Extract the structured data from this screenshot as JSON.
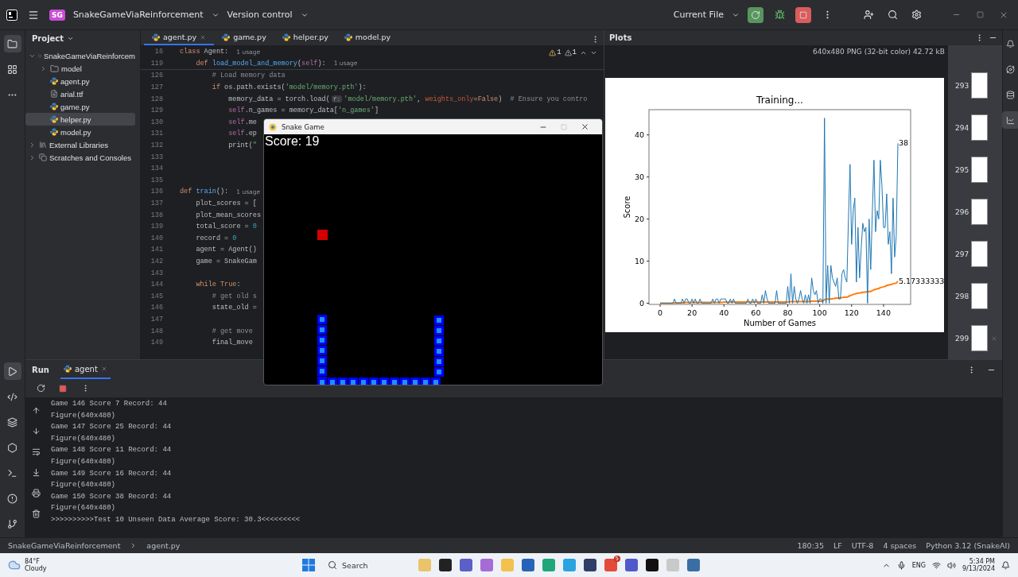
{
  "title_bar": {
    "project_badge": "SG",
    "project": "SnakeGameViaReinforcement",
    "vcs": "Version control",
    "run_config": "Current File"
  },
  "project_panel": {
    "title": "Project",
    "tree": [
      {
        "label": "SnakeGameViaReinforcem",
        "kind": "folder",
        "expanded": true,
        "selected": false,
        "children": [
          {
            "label": "model",
            "kind": "folder",
            "expanded": false,
            "selected": false
          },
          {
            "label": "agent.py",
            "kind": "python",
            "selected": false
          },
          {
            "label": "arial.ttf",
            "kind": "font",
            "selected": false
          },
          {
            "label": "game.py",
            "kind": "python",
            "selected": false
          },
          {
            "label": "helper.py",
            "kind": "python",
            "selected": true
          },
          {
            "label": "model.py",
            "kind": "python",
            "selected": false
          }
        ]
      },
      {
        "label": "External Libraries",
        "kind": "library",
        "expanded": false,
        "selected": false
      },
      {
        "label": "Scratches and Consoles",
        "kind": "scratch",
        "expanded": false,
        "selected": false
      }
    ]
  },
  "editor": {
    "tabs": [
      {
        "label": "agent.py",
        "selected": true
      },
      {
        "label": "game.py",
        "selected": false
      },
      {
        "label": "helper.py",
        "selected": false
      },
      {
        "label": "model.py",
        "selected": false
      }
    ],
    "warnings": [
      "1",
      "1"
    ],
    "sticky_lines": [
      {
        "no": "16",
        "parts": [
          {
            "t": "class",
            "kind": "kw"
          },
          {
            "t": " Agent:",
            "kind": "plain"
          },
          {
            "t": "1 usage",
            "kind": "hint"
          }
        ]
      },
      {
        "no": "119",
        "parts": [
          {
            "t": "    def",
            "kind": "kw"
          },
          {
            "t": " load_model_and_memory",
            "kind": "fn"
          },
          {
            "t": "(",
            "kind": "plain"
          },
          {
            "t": "self",
            "kind": "self"
          },
          {
            "t": "):",
            "kind": "plain"
          },
          {
            "t": "1 usage",
            "kind": "hint"
          }
        ]
      }
    ],
    "lines": [
      {
        "no": "126",
        "parts": [
          {
            "t": "        # Load memory data",
            "kind": "comment"
          }
        ]
      },
      {
        "no": "127",
        "parts": [
          {
            "t": "        if",
            "kind": "kw"
          },
          {
            "t": " os.path.exists(",
            "kind": "plain"
          },
          {
            "t": "'model/memory.pth'",
            "kind": "str"
          },
          {
            "t": "):",
            "kind": "plain"
          }
        ]
      },
      {
        "no": "128",
        "parts": [
          {
            "t": "            memory_data = torch.load(",
            "kind": "plain"
          },
          {
            "t": "f:",
            "kind": "inlay"
          },
          {
            "t": "'model/memory.pth'",
            "kind": "str"
          },
          {
            "t": ", ",
            "kind": "plain"
          },
          {
            "t": "weights_only",
            "kind": "param"
          },
          {
            "t": "=",
            "kind": "plain"
          },
          {
            "t": "False",
            "kind": "kw"
          },
          {
            "t": ")  ",
            "kind": "plain"
          },
          {
            "t": "# Ensure you contro",
            "kind": "comment"
          }
        ]
      },
      {
        "no": "129",
        "parts": [
          {
            "t": "            self",
            "kind": "self"
          },
          {
            "t": ".n_games = memory_data[",
            "kind": "plain"
          },
          {
            "t": "'n_games'",
            "kind": "str"
          },
          {
            "t": "]",
            "kind": "plain"
          }
        ]
      },
      {
        "no": "130",
        "parts": [
          {
            "t": "            self",
            "kind": "self"
          },
          {
            "t": ".me",
            "kind": "plain"
          }
        ]
      },
      {
        "no": "131",
        "parts": [
          {
            "t": "            self",
            "kind": "self"
          },
          {
            "t": ".ep",
            "kind": "plain"
          }
        ]
      },
      {
        "no": "132",
        "parts": [
          {
            "t": "            print(",
            "kind": "plain"
          },
          {
            "t": "\"",
            "kind": "str"
          }
        ]
      },
      {
        "no": "133"
      },
      {
        "no": "134"
      },
      {
        "no": "135"
      },
      {
        "no": "136",
        "parts": [
          {
            "t": "def",
            "kind": "kw"
          },
          {
            "t": " train",
            "kind": "fn"
          },
          {
            "t": "():",
            "kind": "plain"
          },
          {
            "t": "1 usage",
            "kind": "hint"
          }
        ]
      },
      {
        "no": "137",
        "parts": [
          {
            "t": "    plot_scores = [",
            "kind": "plain"
          }
        ]
      },
      {
        "no": "138",
        "parts": [
          {
            "t": "    plot_mean_scores",
            "kind": "plain"
          }
        ]
      },
      {
        "no": "139",
        "parts": [
          {
            "t": "    total_score = ",
            "kind": "plain"
          },
          {
            "t": "0",
            "kind": "num"
          }
        ]
      },
      {
        "no": "140",
        "parts": [
          {
            "t": "    record = ",
            "kind": "plain"
          },
          {
            "t": "0",
            "kind": "num"
          }
        ]
      },
      {
        "no": "141",
        "parts": [
          {
            "t": "    agent = Agent()",
            "kind": "plain"
          }
        ]
      },
      {
        "no": "142",
        "parts": [
          {
            "t": "    game = SnakeGam",
            "kind": "plain"
          }
        ]
      },
      {
        "no": "143"
      },
      {
        "no": "144",
        "parts": [
          {
            "t": "    while",
            "kind": "kw"
          },
          {
            "t": " True",
            "kind": "kw"
          },
          {
            "t": ":",
            "kind": "plain"
          }
        ]
      },
      {
        "no": "145",
        "parts": [
          {
            "t": "        # get old s",
            "kind": "comment"
          }
        ]
      },
      {
        "no": "146",
        "parts": [
          {
            "t": "        state_old =",
            "kind": "plain"
          }
        ]
      },
      {
        "no": "147"
      },
      {
        "no": "148",
        "parts": [
          {
            "t": "        # get move",
            "kind": "comment"
          }
        ]
      },
      {
        "no": "149",
        "parts": [
          {
            "t": "        final_move",
            "kind": "plain"
          }
        ]
      }
    ]
  },
  "plots": {
    "title": "Plots",
    "image_info": "640x480 PNG (32-bit color) 42.72 kB",
    "chart_data": {
      "type": "line",
      "title": "Training...",
      "xlabel": "Number of Games",
      "ylabel": "Score",
      "xlim": [
        -7,
        157
      ],
      "ylim": [
        0,
        46
      ],
      "xticks": [
        0,
        20,
        40,
        60,
        80,
        100,
        120,
        140
      ],
      "yticks": [
        0,
        10,
        20,
        30,
        40
      ],
      "x": [
        0,
        1,
        2,
        3,
        4,
        5,
        6,
        7,
        8,
        9,
        10,
        11,
        12,
        13,
        14,
        15,
        16,
        17,
        18,
        19,
        20,
        21,
        22,
        23,
        24,
        25,
        26,
        27,
        28,
        29,
        30,
        31,
        32,
        33,
        34,
        35,
        36,
        37,
        38,
        39,
        40,
        41,
        42,
        43,
        44,
        45,
        46,
        47,
        48,
        49,
        50,
        51,
        52,
        53,
        54,
        55,
        56,
        57,
        58,
        59,
        60,
        61,
        62,
        63,
        64,
        65,
        66,
        67,
        68,
        69,
        70,
        71,
        72,
        73,
        74,
        75,
        76,
        77,
        78,
        79,
        80,
        81,
        82,
        83,
        84,
        85,
        86,
        87,
        88,
        89,
        90,
        91,
        92,
        93,
        94,
        95,
        96,
        97,
        98,
        99,
        100,
        101,
        102,
        103,
        104,
        105,
        106,
        107,
        108,
        109,
        110,
        111,
        112,
        113,
        114,
        115,
        116,
        117,
        118,
        119,
        120,
        121,
        122,
        123,
        124,
        125,
        126,
        127,
        128,
        129,
        130,
        131,
        132,
        133,
        134,
        135,
        136,
        137,
        138,
        139,
        140,
        141,
        142,
        143,
        144,
        145,
        146,
        147,
        148,
        149
      ],
      "series": [
        {
          "color": "#1f77b4",
          "values": [
            0,
            0,
            0,
            0,
            0,
            0,
            0,
            0,
            0,
            1,
            0,
            0,
            0,
            0,
            1,
            0,
            1,
            1,
            0,
            0,
            1,
            0,
            1,
            0,
            0,
            1,
            0,
            0,
            0,
            0,
            0,
            0,
            0,
            1,
            0,
            1,
            1,
            0,
            1,
            1,
            1,
            1,
            0,
            0,
            1,
            0,
            1,
            0,
            0,
            0,
            0,
            0,
            0,
            0,
            0,
            1,
            0,
            0,
            1,
            0,
            1,
            0,
            0,
            0,
            2,
            0,
            3,
            1,
            0,
            0,
            0,
            0,
            0,
            3,
            0,
            0,
            0,
            0,
            0,
            0,
            4,
            0,
            7,
            0,
            4,
            1,
            0,
            1,
            3,
            1,
            0,
            2,
            0,
            2,
            0,
            6,
            3,
            2,
            3,
            0,
            1,
            1,
            0,
            44,
            0,
            9,
            0,
            9,
            6,
            5,
            4,
            6,
            1,
            1,
            7,
            8,
            6,
            5,
            20,
            33,
            14,
            22,
            25,
            5,
            18,
            6,
            13,
            19,
            17,
            18,
            0,
            20,
            8,
            22,
            34,
            17,
            22,
            20,
            34,
            28,
            18,
            18,
            26,
            14,
            17,
            7,
            25,
            11,
            16,
            38
          ]
        },
        {
          "color": "#ff7f0e",
          "values": [
            0,
            0,
            0,
            0,
            0,
            0,
            0,
            0,
            0,
            0.1,
            0.1,
            0.1,
            0.1,
            0.1,
            0.1,
            0.1,
            0.2,
            0.2,
            0.2,
            0.2,
            0.2,
            0.2,
            0.2,
            0.2,
            0.2,
            0.2,
            0.2,
            0.2,
            0.2,
            0.2,
            0.2,
            0.2,
            0.2,
            0.2,
            0.2,
            0.2,
            0.2,
            0.2,
            0.2,
            0.2,
            0.3,
            0.3,
            0.3,
            0.3,
            0.3,
            0.3,
            0.3,
            0.3,
            0.3,
            0.3,
            0.3,
            0.3,
            0.3,
            0.3,
            0.3,
            0.3,
            0.3,
            0.3,
            0.3,
            0.3,
            0.3,
            0.3,
            0.3,
            0.3,
            0.3,
            0.3,
            0.3,
            0.3,
            0.3,
            0.3,
            0.3,
            0.3,
            0.3,
            0.3,
            0.3,
            0.3,
            0.3,
            0.3,
            0.3,
            0.3,
            0.3,
            0.3,
            0.4,
            0.4,
            0.4,
            0.4,
            0.4,
            0.4,
            0.4,
            0.4,
            0.4,
            0.4,
            0.4,
            0.4,
            0.4,
            0.5,
            0.5,
            0.5,
            0.5,
            0.5,
            0.5,
            0.5,
            0.5,
            0.9,
            0.9,
            1.0,
            1.0,
            1.0,
            1.1,
            1.1,
            1.2,
            1.2,
            1.2,
            1.3,
            1.3,
            1.4,
            1.4,
            1.4,
            1.6,
            1.8,
            1.9,
            2.1,
            2.2,
            2.3,
            2.4,
            2.4,
            2.5,
            2.6,
            2.6,
            2.7,
            2.7,
            2.8,
            2.8,
            3.0,
            3.2,
            3.3,
            3.4,
            3.5,
            3.7,
            3.8,
            3.9,
            4.0,
            4.2,
            4.3,
            4.4,
            4.5,
            4.6,
            4.7,
            4.8,
            5.2
          ]
        }
      ],
      "annotations": [
        {
          "x": 149,
          "y": 38,
          "text": "38"
        },
        {
          "x": 149,
          "y": 5.2,
          "text": "5.17333333"
        }
      ]
    },
    "thumbnails": [
      {
        "label": "293"
      },
      {
        "label": "294"
      },
      {
        "label": "295"
      },
      {
        "label": "296"
      },
      {
        "label": "297"
      },
      {
        "label": "298"
      },
      {
        "label": "299"
      }
    ]
  },
  "game_window": {
    "title": "Snake Game",
    "score": "Score: 19"
  },
  "run_panel": {
    "title": "Run",
    "tabs": [
      {
        "label": "agent",
        "selected": true
      }
    ],
    "console": [
      "Game 146 Score 7 Record: 44",
      "Figure(640x480)",
      "Game 147 Score 25 Record: 44",
      "Figure(640x480)",
      "Game 148 Score 11 Record: 44",
      "Figure(640x480)",
      "Game 149 Score 16 Record: 44",
      "Figure(640x480)",
      "Game 150 Score 38 Record: 44",
      "Figure(640x480)",
      ">>>>>>>>>>Test 10 Unseen Data Average Score: 30.3<<<<<<<<<"
    ]
  },
  "status_bar": {
    "breadcrumbs": [
      "SnakeGameViaReinforcement",
      "agent.py"
    ],
    "position": "180:35",
    "line_sep": "LF",
    "encoding": "UTF-8",
    "indent": "4 spaces",
    "interpreter": "Python 3.12 (SnakeAI)"
  },
  "taskbar": {
    "temperature": "84°F",
    "weather": "Cloudy",
    "search": "Search",
    "chrome_badge": "5",
    "language": "ENG",
    "time": "5:34 PM",
    "date": "9/13/2024"
  }
}
